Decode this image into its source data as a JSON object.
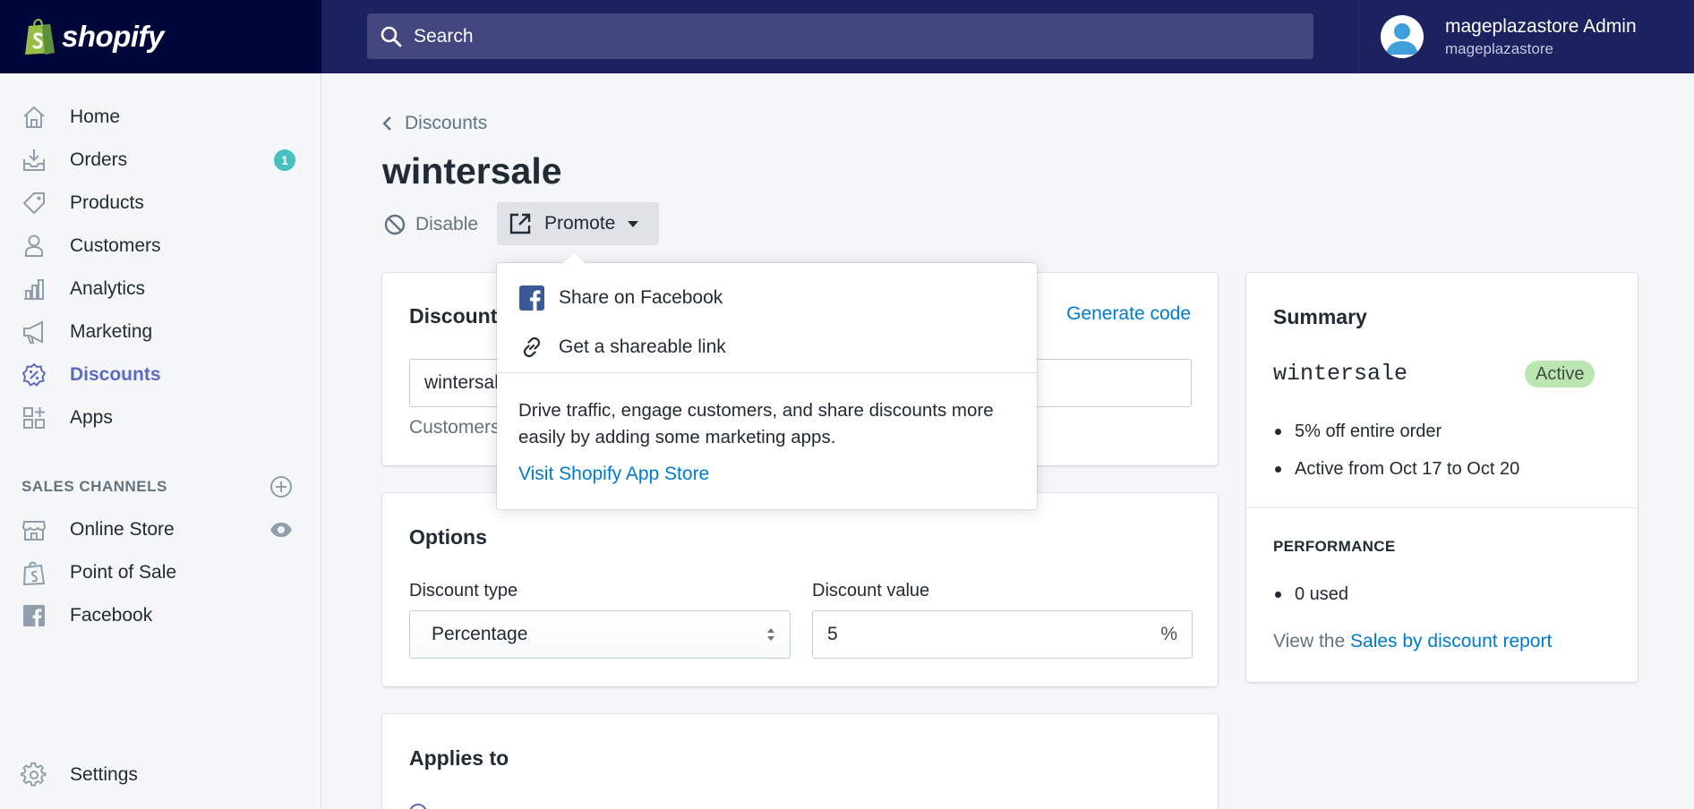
{
  "brand": {
    "name": "shopify",
    "colors": {
      "topbar": "#1c2260",
      "brand_bg": "#000639",
      "accent": "#5c6ac4",
      "link": "#007ace",
      "badge": "#47c1bf",
      "active_pill": "#bbe5b3"
    }
  },
  "search": {
    "placeholder": "Search",
    "icon": "search-icon"
  },
  "account": {
    "name": "mageplazastore Admin",
    "store": "mageplazastore"
  },
  "sidebar": {
    "items": [
      {
        "label": "Home",
        "icon": "home-icon"
      },
      {
        "label": "Orders",
        "icon": "orders-icon",
        "badge": "1"
      },
      {
        "label": "Products",
        "icon": "tag-icon"
      },
      {
        "label": "Customers",
        "icon": "person-icon"
      },
      {
        "label": "Analytics",
        "icon": "bar-chart-icon"
      },
      {
        "label": "Marketing",
        "icon": "megaphone-icon"
      },
      {
        "label": "Discounts",
        "icon": "discount-icon",
        "active": true
      },
      {
        "label": "Apps",
        "icon": "apps-icon"
      }
    ],
    "sales_channels_heading": "SALES CHANNELS",
    "channels": [
      {
        "label": "Online Store",
        "icon": "store-icon"
      },
      {
        "label": "Point of Sale",
        "icon": "pos-bag-icon"
      },
      {
        "label": "Facebook",
        "icon": "facebook-icon"
      }
    ],
    "settings_label": "Settings"
  },
  "main": {
    "breadcrumb": "Discounts",
    "title": "wintersale",
    "actions": {
      "disable": "Disable",
      "promote": "Promote"
    },
    "code_card": {
      "title_visible": "Discount",
      "generate": "Generate code",
      "value": "wintersale",
      "help_visible": "Customers"
    },
    "options": {
      "title": "Options",
      "type_label": "Discount type",
      "type_value": "Percentage",
      "value_label": "Discount value",
      "value": "5",
      "suffix": "%"
    },
    "applies": {
      "title": "Applies to"
    }
  },
  "popover": {
    "share_facebook": "Share on Facebook",
    "share_link": "Get a shareable link",
    "text": "Drive traffic, engage customers, and share discounts more easily by adding some marketing apps.",
    "store_link": "Visit Shopify App Store"
  },
  "summary": {
    "title": "Summary",
    "code": "wintersale",
    "status": "Active",
    "bullets": [
      "5% off entire order",
      "Active from Oct 17 to Oct 20"
    ],
    "performance_heading": "PERFORMANCE",
    "performance_bullets": [
      "0 used"
    ],
    "report_prefix": "View the",
    "report_link": "Sales by discount report"
  }
}
